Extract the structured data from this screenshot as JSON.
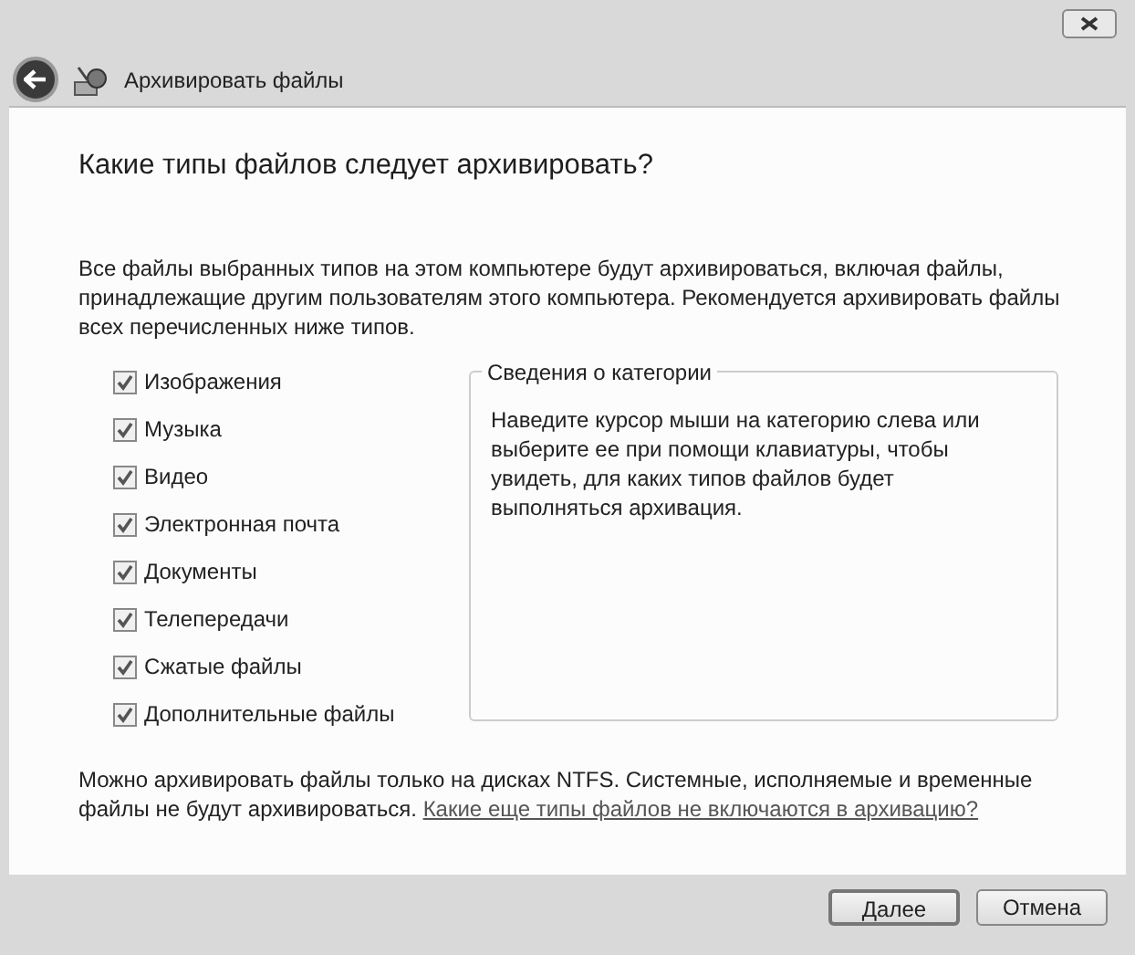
{
  "window": {
    "title": "Архивировать файлы"
  },
  "heading": "Какие типы файлов следует архивировать?",
  "intro": "Все файлы выбранных типов на этом компьютере будут архивироваться, включая файлы, принадлежащие другим пользователям этого компьютера. Рекомендуется архивировать файлы всех перечисленных ниже типов.",
  "categories": [
    {
      "label": "Изображения",
      "checked": true
    },
    {
      "label": "Музыка",
      "checked": true
    },
    {
      "label": "Видео",
      "checked": true
    },
    {
      "label": "Электронная почта",
      "checked": true
    },
    {
      "label": "Документы",
      "checked": true
    },
    {
      "label": "Телепередачи",
      "checked": true
    },
    {
      "label": "Сжатые файлы",
      "checked": true
    },
    {
      "label": "Дополнительные файлы",
      "checked": true
    }
  ],
  "details": {
    "title": "Сведения о категории",
    "text": "Наведите курсор мыши на категорию слева или выберите ее при помощи клавиатуры, чтобы увидеть, для каких типов файлов будет выполняться архивация."
  },
  "note": {
    "text": "Можно архивировать файлы только на дисках NTFS. Системные, исполняемые и временные файлы не будут архивироваться.",
    "link": "Какие еще типы файлов не включаются в архивацию?"
  },
  "buttons": [
    {
      "label": "Далее",
      "kind": "default"
    },
    {
      "label": "Отмена",
      "kind": "normal"
    }
  ]
}
